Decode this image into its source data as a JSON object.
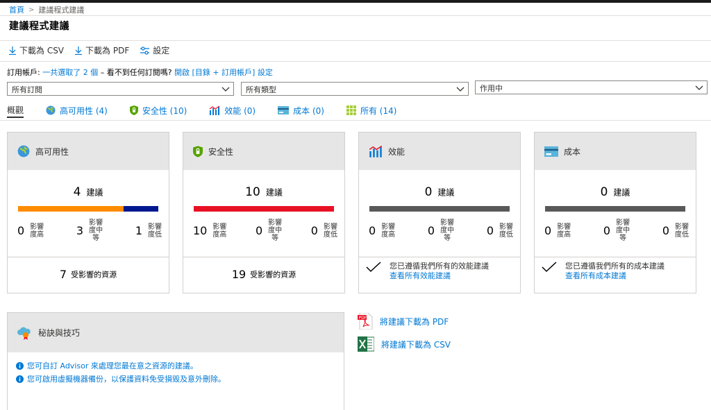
{
  "breadcrumb": {
    "home": "首頁",
    "current": "建議程式建議"
  },
  "page": {
    "title": "建議程式建議"
  },
  "toolbar": {
    "download_csv": "下載為 CSV",
    "download_pdf": "下載為 PDF",
    "settings": "設定"
  },
  "subscription": {
    "label": "訂用帳戶:",
    "selected": "一共選取了 2 個",
    "mid": " – 看不到任何訂閱嗎?",
    "link": "開啟 [目錄 + 訂用帳戶] 設定"
  },
  "filters": {
    "subscriptions": "所有訂閱",
    "types": "所有類型",
    "status": "作用中"
  },
  "tabs": [
    {
      "label": "概觀",
      "icon": "overview"
    },
    {
      "label": "高可用性 (4)",
      "icon": "globe-icon"
    },
    {
      "label": "安全性 (10)",
      "icon": "shield-icon"
    },
    {
      "label": "效能 (0)",
      "icon": "performance-chart-icon"
    },
    {
      "label": "成本 (0)",
      "icon": "cost-card-icon"
    },
    {
      "label": "所有 (14)",
      "icon": "grid-icon"
    }
  ],
  "common": {
    "recs": "建議",
    "high": "影響度高",
    "medium": "影響度中等",
    "low": "影響度低",
    "affected": "受影響的資源"
  },
  "cards": [
    {
      "title": "高可用性",
      "icon": "globe-icon",
      "count": "4",
      "high": "0",
      "medium": "3",
      "low": "1",
      "affected": "7",
      "bar": [
        {
          "fraction": 0.75,
          "color": "#ff8c00"
        },
        {
          "fraction": 0.25,
          "color": "#00188f"
        }
      ]
    },
    {
      "title": "安全性",
      "icon": "shield-icon",
      "count": "10",
      "high": "10",
      "medium": "0",
      "low": "0",
      "affected": "19",
      "bar": [
        {
          "fraction": 1.0,
          "color": "#e81123"
        }
      ]
    },
    {
      "title": "效能",
      "icon": "performance-chart-icon",
      "count": "0",
      "high": "0",
      "medium": "0",
      "low": "0",
      "bar": [
        {
          "fraction": 1.0,
          "color": "#595959"
        }
      ],
      "note": "您已遵循我們所有的效能建議",
      "link": "查看所有效能建議"
    },
    {
      "title": "成本",
      "icon": "cost-card-icon",
      "count": "0",
      "high": "0",
      "medium": "0",
      "low": "0",
      "bar": [
        {
          "fraction": 1.0,
          "color": "#595959"
        }
      ],
      "note": "您已遵循我們所有的成本建議",
      "link": "查看所有成本建議"
    }
  ],
  "tips": {
    "title": "秘訣與技巧",
    "items": [
      "您可自訂 Advisor 來處理您最在意之資源的建議。",
      "您可啟用虛擬機器備份，以保護資料免受損毀及意外刪除。"
    ]
  },
  "downloads": {
    "pdf": "將建議下載為 PDF",
    "csv": "將建議下載為 CSV"
  },
  "colors": {
    "link": "#0078d4",
    "header_bg": "#e6e6e6"
  }
}
